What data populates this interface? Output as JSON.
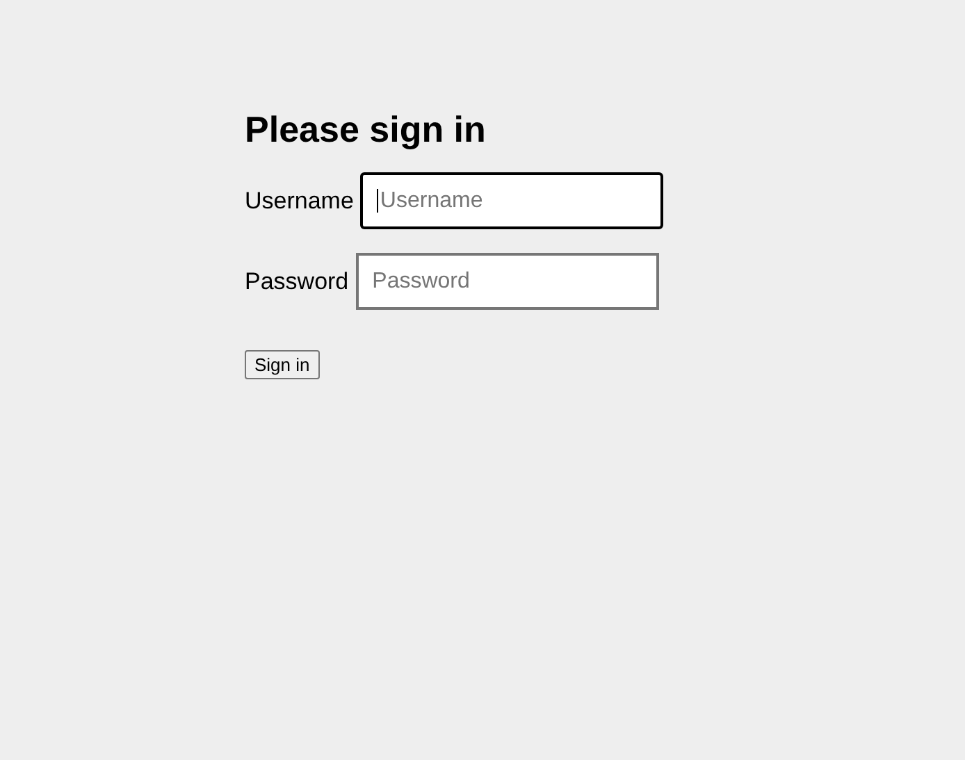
{
  "title": "Please sign in",
  "fields": [
    {
      "label": "Username",
      "placeholder": "Username",
      "focused": true
    },
    {
      "label": "Password",
      "placeholder": "Password",
      "focused": false
    }
  ],
  "button": "Sign in"
}
